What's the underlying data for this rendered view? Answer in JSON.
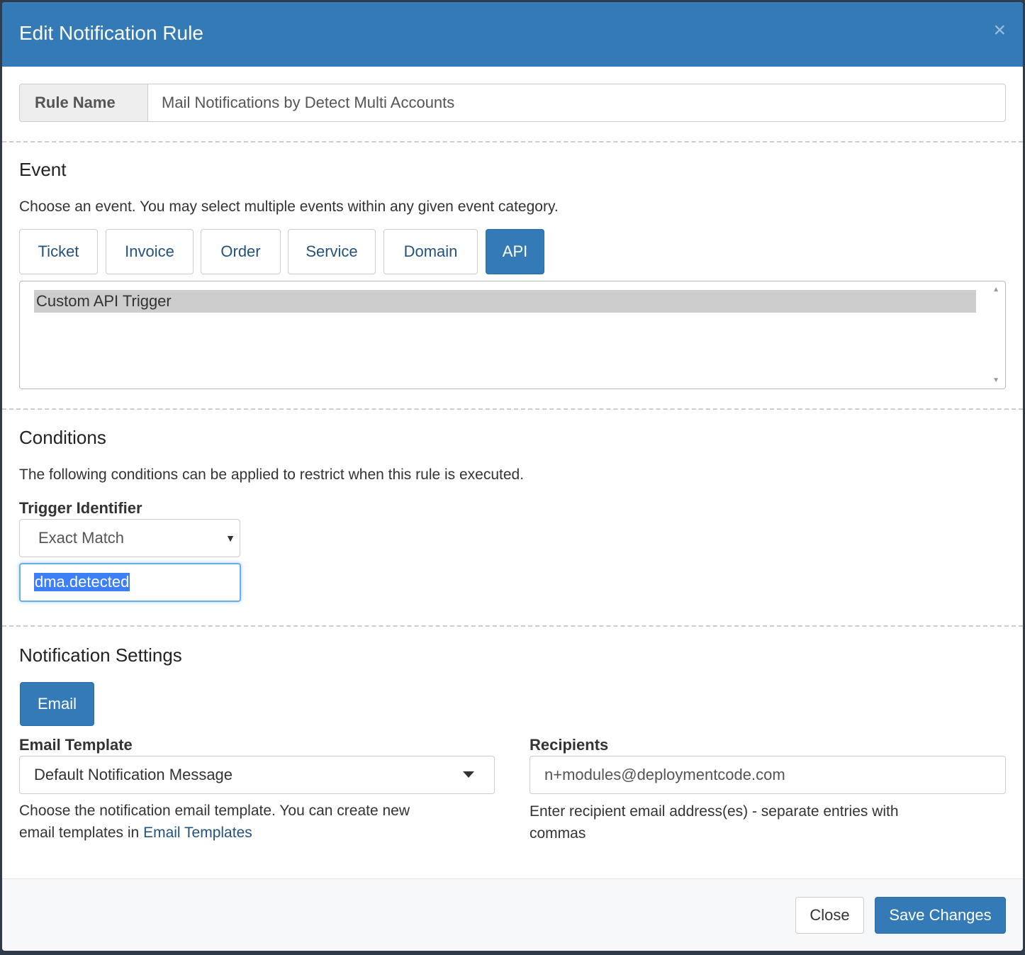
{
  "modal": {
    "title": "Edit Notification Rule",
    "close_symbol": "×"
  },
  "rule_name": {
    "label": "Rule Name",
    "value": "Mail Notifications by Detect Multi Accounts"
  },
  "event": {
    "title": "Event",
    "help": "Choose an event. You may select multiple events within any given event category.",
    "tabs": [
      {
        "label": "Ticket"
      },
      {
        "label": "Invoice"
      },
      {
        "label": "Order"
      },
      {
        "label": "Service"
      },
      {
        "label": "Domain"
      },
      {
        "label": "API",
        "active": true
      }
    ],
    "options": [
      "Custom API Trigger"
    ],
    "selected_option": "Custom API Trigger"
  },
  "conditions": {
    "title": "Conditions",
    "help": "The following conditions can be applied to restrict when this rule is executed.",
    "trigger_label": "Trigger Identifier",
    "match_type": "Exact Match",
    "trigger_value": "dma.detected"
  },
  "notification": {
    "title": "Notification Settings",
    "method_button": "Email",
    "template_label": "Email Template",
    "template_value": "Default Notification Message",
    "template_help_line1": "Choose the notification email template. You can create new",
    "template_help_line2": "email templates in ",
    "template_help_link": "Email Templates",
    "recipients_label": "Recipients",
    "recipients_value": "n+modules@deploymentcode.com",
    "recipients_help_line1": "Enter recipient email address(es) - separate entries with",
    "recipients_help_line2": "commas"
  },
  "footer": {
    "close_label": "Close",
    "save_label": "Save Changes"
  },
  "colors": {
    "primary": "#337ab7",
    "header": "#337ab7",
    "link": "#23527c",
    "selection": "#3d7ff7"
  }
}
